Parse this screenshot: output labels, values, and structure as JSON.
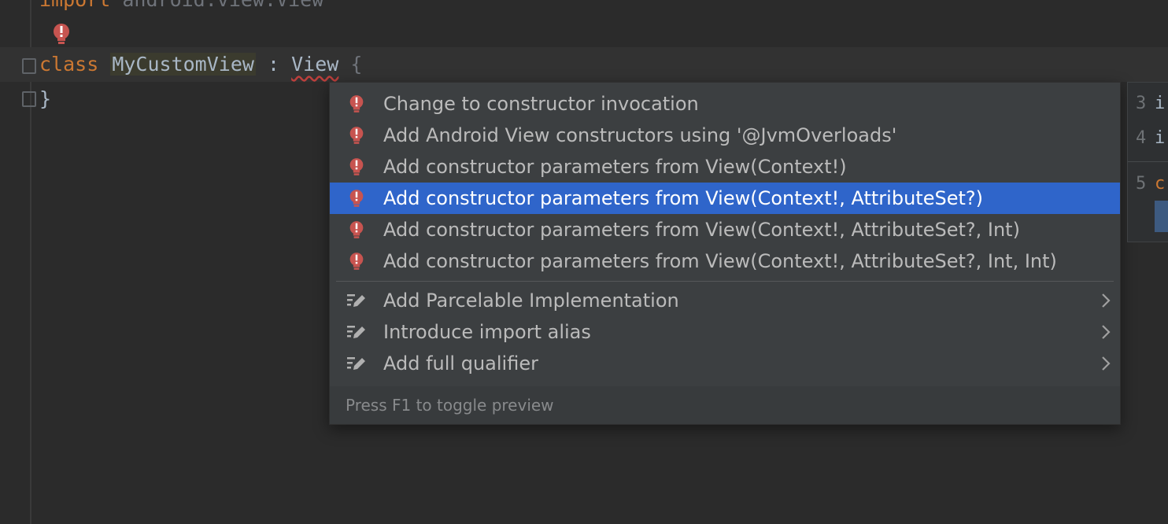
{
  "editor": {
    "import_line": {
      "kw": "import",
      "rest": " android.view.View"
    },
    "class_line": {
      "kw": "class",
      "name": "MyCustomView",
      "sep": " : ",
      "parent": "View",
      "brace": " {"
    },
    "close_line": "}"
  },
  "intention_menu": {
    "items": [
      {
        "label": "Change to constructor invocation",
        "icon": "error-bulb-icon",
        "selected": false
      },
      {
        "label": "Add Android View constructors using '@JvmOverloads'",
        "icon": "error-bulb-icon",
        "selected": false
      },
      {
        "label": "Add constructor parameters from View(Context!)",
        "icon": "error-bulb-icon",
        "selected": false
      },
      {
        "label": "Add constructor parameters from View(Context!, AttributeSet?)",
        "icon": "error-bulb-icon",
        "selected": true
      },
      {
        "label": "Add constructor parameters from View(Context!, AttributeSet?, Int)",
        "icon": "error-bulb-icon",
        "selected": false
      },
      {
        "label": "Add constructor parameters from View(Context!, AttributeSet?, Int, Int)",
        "icon": "error-bulb-icon",
        "selected": false
      }
    ],
    "secondary_items": [
      {
        "label": "Add Parcelable Implementation",
        "icon": "pencil-edit-icon",
        "has_submenu": true
      },
      {
        "label": "Introduce import alias",
        "icon": "pencil-edit-icon",
        "has_submenu": true
      },
      {
        "label": "Add full qualifier",
        "icon": "pencil-edit-icon",
        "has_submenu": true
      }
    ],
    "footer": "Press F1 to toggle preview"
  },
  "preview_panel": {
    "lines": [
      {
        "num": "3",
        "text": "i"
      },
      {
        "num": "4",
        "text": "i"
      },
      {
        "num": "5",
        "text": "c"
      }
    ]
  },
  "colors": {
    "background": "#2b2b2b",
    "keyword": "#cc7832",
    "selection": "#2f65ca",
    "error": "#c75450"
  }
}
